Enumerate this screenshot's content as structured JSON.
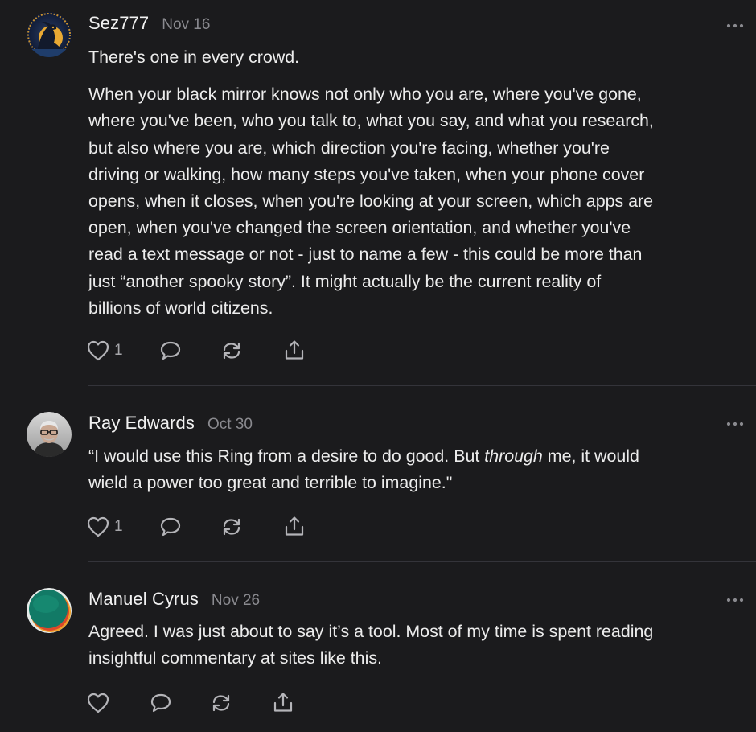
{
  "comments": [
    {
      "author": "Sez777",
      "date": "Nov 16",
      "avatar_icon": "raven-moon-avatar",
      "lines_p1": [
        "There's one in every crowd."
      ],
      "lines_p2": [
        "When your black mirror knows not only who you are, where you've gone,",
        "where you've been, who you talk to, what you say, and what you research,",
        "but also where you are, which direction you're facing, whether you're",
        "driving or walking, how many steps you've taken, when your phone cover",
        "opens, when it closes, when you're looking at your screen, which apps are",
        "open, when you've changed the screen orientation, and whether you've",
        "read a text message or not - just to name a few -  this could be more than",
        "just “another spooky story”. It might actually be the current reality of",
        "billions of world citizens."
      ],
      "likes": "1"
    },
    {
      "author": "Ray Edwards",
      "date": "Oct 30",
      "avatar_icon": "photo-avatar",
      "line1_before": "“I would use this Ring from a desire to do good. But ",
      "line1_italic": "through",
      "line1_after": " me, it would",
      "line2": "wield a power too great and terrible to imagine.\"",
      "likes": "1"
    },
    {
      "author": "Manuel Cyrus",
      "date": "Nov 26",
      "avatar_icon": "gradient-circle-avatar",
      "lines": [
        "Agreed. I was just about to say it’s a tool. Most of my time is spent reading",
        "insightful commentary at sites like this."
      ],
      "likes": ""
    }
  ],
  "icons": {
    "like": "heart-icon",
    "reply": "speech-bubble-icon",
    "restack": "restack-icon",
    "share": "share-icon",
    "more": "ellipsis-icon"
  },
  "colors": {
    "background": "#1b1b1d",
    "text": "#ececec",
    "muted": "#8a8a8f",
    "icon": "#b4b4b8",
    "divider": "#34343a"
  }
}
